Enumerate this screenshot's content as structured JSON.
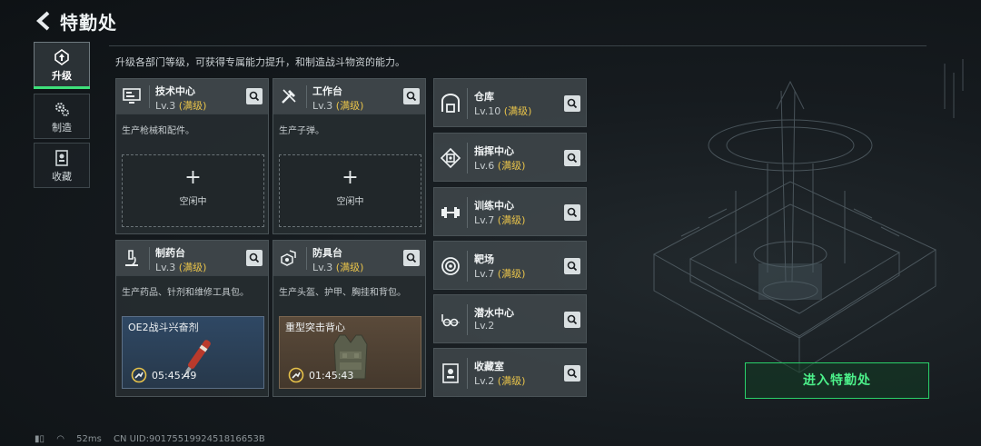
{
  "header": {
    "title": "特勤处",
    "description": "升级各部门等级，可获得专属能力提升，和制造战斗物资的能力。"
  },
  "nav": [
    {
      "label": "升级",
      "icon": "upgrade-icon",
      "active": true
    },
    {
      "label": "制造",
      "icon": "gears-icon",
      "active": false
    },
    {
      "label": "收藏",
      "icon": "collection-icon",
      "active": false
    }
  ],
  "cards": {
    "tech": {
      "name": "技术中心",
      "level": "Lv.3",
      "max": "(满级)",
      "desc": "生产枪械和配件。",
      "slot": {
        "plus": "+",
        "status": "空闲中"
      }
    },
    "workbench": {
      "name": "工作台",
      "level": "Lv.3",
      "max": "(满级)",
      "desc": "生产子弹。",
      "slot": {
        "plus": "+",
        "status": "空闲中"
      }
    },
    "pharmacy": {
      "name": "制药台",
      "level": "Lv.3",
      "max": "(满级)",
      "desc": "生产药品、针剂和维修工具包。",
      "craft": {
        "item": "OE2战斗兴奋剂",
        "time": "05:45:49"
      }
    },
    "armor": {
      "name": "防具台",
      "level": "Lv.3",
      "max": "(满级)",
      "desc": "生产头盔、护甲、胸挂和背包。",
      "craft": {
        "item": "重型突击背心",
        "time": "01:45:43"
      }
    }
  },
  "facilities": [
    {
      "name": "仓库",
      "level": "Lv.10",
      "max": "(满级)",
      "icon": "warehouse-icon"
    },
    {
      "name": "指挥中心",
      "level": "Lv.6",
      "max": "(满级)",
      "icon": "command-center-icon"
    },
    {
      "name": "训练中心",
      "level": "Lv.7",
      "max": "(满级)",
      "icon": "dumbbell-icon"
    },
    {
      "name": "靶场",
      "level": "Lv.7",
      "max": "(满级)",
      "icon": "target-icon"
    },
    {
      "name": "潜水中心",
      "level": "Lv.2",
      "max": "",
      "icon": "diving-goggles-icon"
    },
    {
      "name": "收藏室",
      "level": "Lv.2",
      "max": "(满级)",
      "icon": "collection-room-icon"
    }
  ],
  "enter_button": "进入特勤处",
  "status": {
    "ping": "52ms",
    "uid": "CN UID:9017551992451816653B"
  },
  "colors": {
    "accent_green": "#2ad16a",
    "max_level_gold": "#e8c34a"
  }
}
